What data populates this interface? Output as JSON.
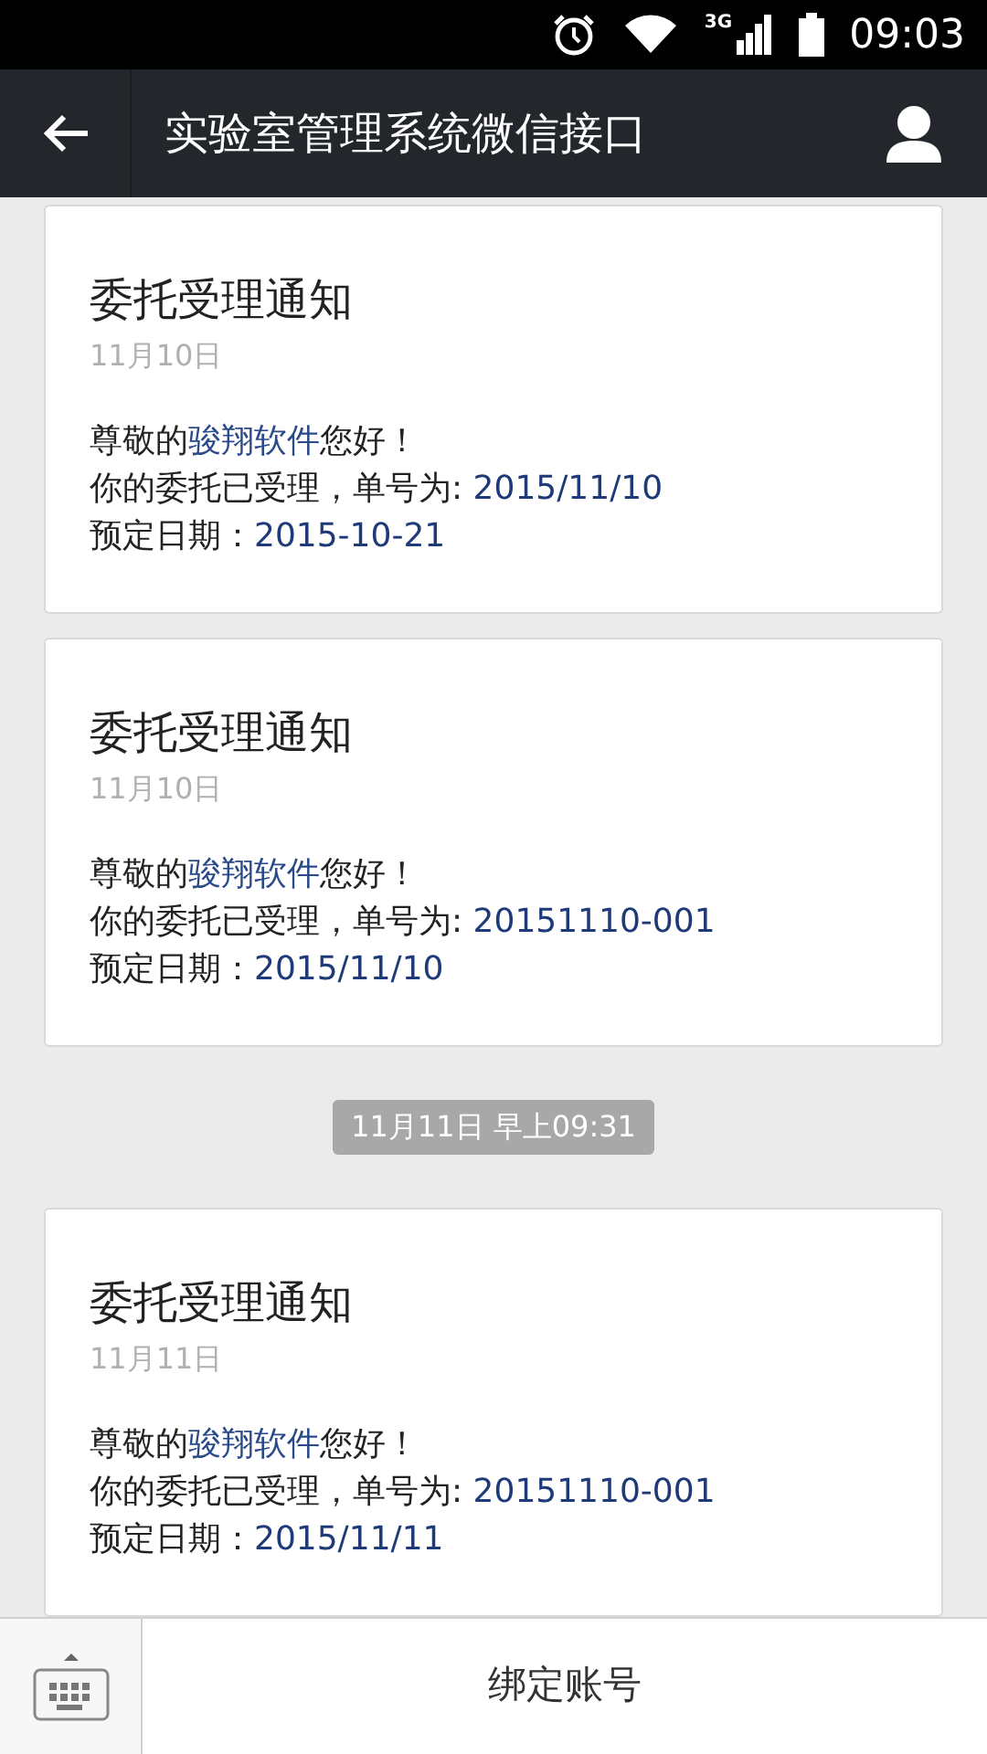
{
  "status_bar": {
    "time": "09:03",
    "network": "3G"
  },
  "header": {
    "title": "实验室管理系统微信接口"
  },
  "feed": [
    {
      "kind": "card",
      "title": "委托受理通知",
      "date": "11月10日",
      "greeting": {
        "before": "尊敬的",
        "name": "骏翔软件",
        "after": "您好！"
      },
      "lines": [
        {
          "label": "你的委托已受理，单号为: ",
          "value": "2015/11/10"
        },
        {
          "label": "预定日期：",
          "value": "2015-10-21"
        }
      ]
    },
    {
      "kind": "card",
      "title": "委托受理通知",
      "date": "11月10日",
      "greeting": {
        "before": "尊敬的",
        "name": "骏翔软件",
        "after": "您好！"
      },
      "lines": [
        {
          "label": "你的委托已受理，单号为: ",
          "value": "20151110-001"
        },
        {
          "label": "预定日期：",
          "value": "2015/11/10"
        }
      ]
    },
    {
      "kind": "timestamp",
      "text": "11月11日 早上09:31"
    },
    {
      "kind": "card",
      "title": "委托受理通知",
      "date": "11月11日",
      "greeting": {
        "before": "尊敬的",
        "name": "骏翔软件",
        "after": "您好！"
      },
      "lines": [
        {
          "label": "你的委托已受理，单号为: ",
          "value": "20151110-001"
        },
        {
          "label": "预定日期：",
          "value": "2015/11/11"
        }
      ]
    }
  ],
  "bottom_bar": {
    "menu": "绑定账号"
  }
}
